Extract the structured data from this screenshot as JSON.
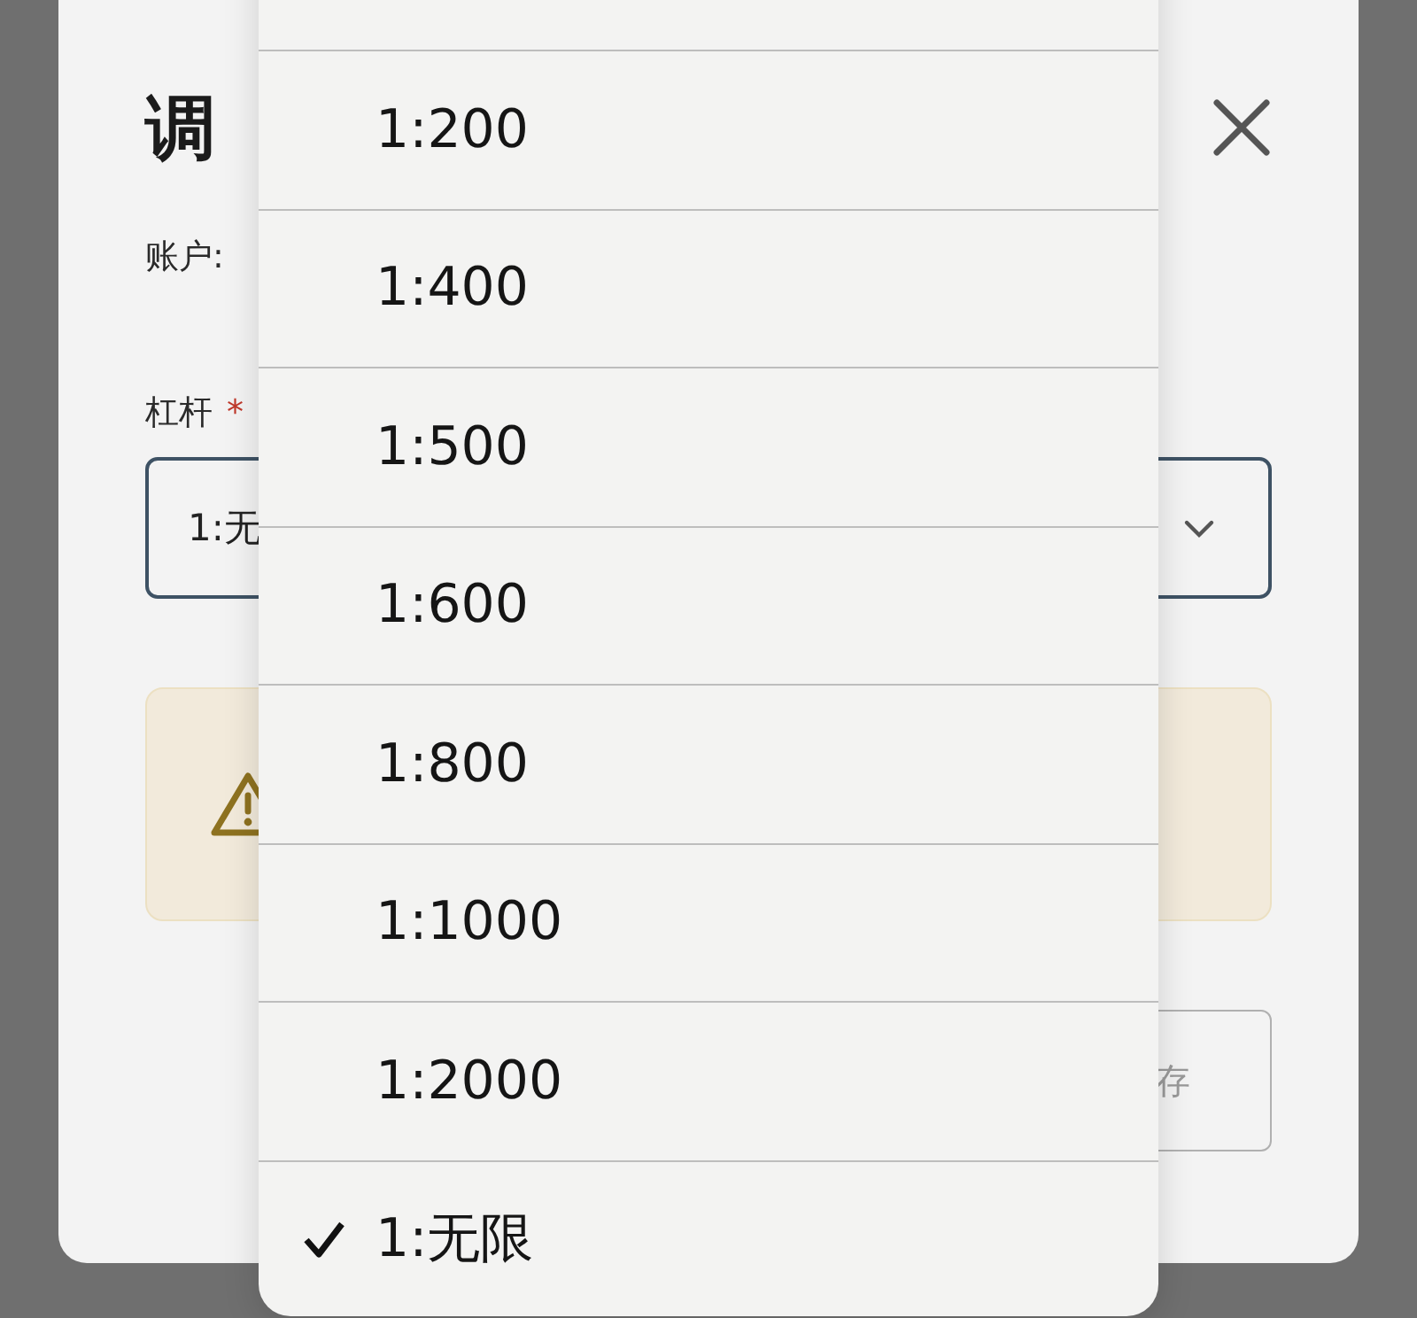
{
  "dialog": {
    "title": "调",
    "account_label": "账户:",
    "leverage_label": "杠杆",
    "required_mark": "*",
    "leverage_value": "1:无",
    "button": "存"
  },
  "leverage_menu": [
    {
      "label": "1:200",
      "selected": false
    },
    {
      "label": "1:400",
      "selected": false
    },
    {
      "label": "1:500",
      "selected": false
    },
    {
      "label": "1:600",
      "selected": false
    },
    {
      "label": "1:800",
      "selected": false
    },
    {
      "label": "1:1000",
      "selected": false
    },
    {
      "label": "1:2000",
      "selected": false
    },
    {
      "label": "1:无限",
      "selected": true
    }
  ]
}
